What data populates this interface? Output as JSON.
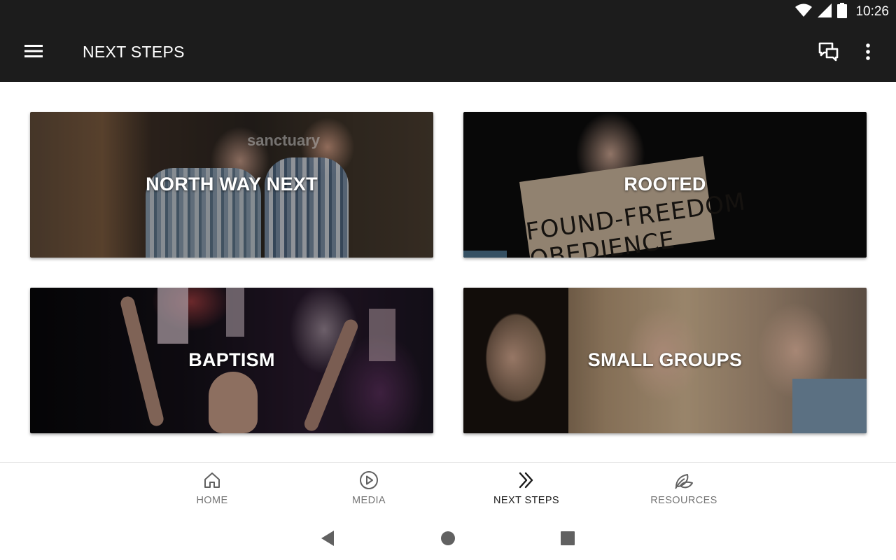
{
  "status_bar": {
    "time": "10:26",
    "icons": [
      "wifi-icon",
      "signal-icon",
      "battery-icon"
    ]
  },
  "app_bar": {
    "title": "NEXT STEPS",
    "icons": [
      "menu-icon",
      "chat-icon",
      "more-vert-icon"
    ]
  },
  "cards": [
    {
      "label": "NORTH WAY NEXT"
    },
    {
      "label": "ROOTED"
    },
    {
      "label": "BAPTISM"
    },
    {
      "label": "SMALL GROUPS"
    }
  ],
  "card_images": {
    "card_1_sign": "sanctuary",
    "card_2_sign": "FOUND-FREEDOM OBEDIENCE"
  },
  "bottom_nav": {
    "items": [
      {
        "label": "HOME",
        "icon": "home-icon",
        "active": false
      },
      {
        "label": "MEDIA",
        "icon": "play-circle-icon",
        "active": false
      },
      {
        "label": "NEXT STEPS",
        "icon": "double-chevron-right-icon",
        "active": true
      },
      {
        "label": "RESOURCES",
        "icon": "leaf-icon",
        "active": false
      }
    ]
  },
  "system_nav": {
    "icons": [
      "back-icon",
      "home-circle-icon",
      "recent-apps-icon"
    ]
  },
  "colors": {
    "app_bar_bg": "#1c1c1c",
    "active_nav": "#1a1a1a",
    "inactive_nav": "#757575"
  }
}
